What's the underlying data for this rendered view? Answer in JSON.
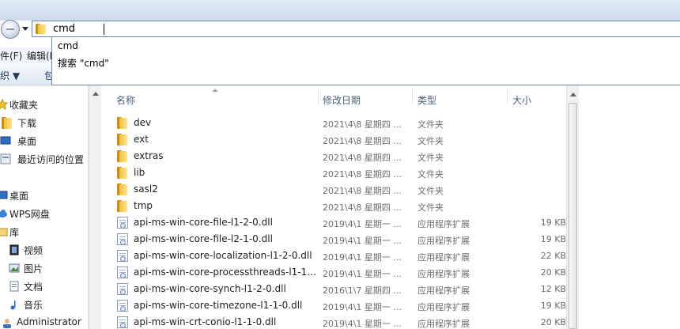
{
  "address": {
    "input_value": "cmd",
    "suggestions": [
      "cmd",
      "搜索 \"cmd\""
    ]
  },
  "menu": [
    "件(F)",
    "编辑(E"
  ],
  "toolbar": [
    "织 ▼",
    "包"
  ],
  "nav": [
    {
      "label": "收藏夹",
      "icon": "star-icon"
    },
    {
      "label": "下载",
      "icon": "download-icon"
    },
    {
      "label": "桌面",
      "icon": "desktop-icon"
    },
    {
      "label": "最近访问的位置",
      "icon": "recent-places-icon"
    },
    {
      "label": "桌面",
      "icon": "desktop-icon"
    },
    {
      "label": "WPS网盘",
      "icon": "cloud-icon"
    },
    {
      "label": "库",
      "icon": "library-icon"
    },
    {
      "label": "视频",
      "icon": "video-icon"
    },
    {
      "label": "图片",
      "icon": "picture-icon"
    },
    {
      "label": "文档",
      "icon": "document-icon"
    },
    {
      "label": "音乐",
      "icon": "music-icon"
    },
    {
      "label": "Administrator",
      "icon": "user-icon"
    }
  ],
  "columns": [
    "名称",
    "修改日期",
    "类型",
    "大小"
  ],
  "files": [
    {
      "name": "dev",
      "date": "2021\\4\\8 星期四 ...",
      "type": "文件夹",
      "size": "",
      "kind": "folder"
    },
    {
      "name": "ext",
      "date": "2021\\4\\8 星期四 ...",
      "type": "文件夹",
      "size": "",
      "kind": "folder"
    },
    {
      "name": "extras",
      "date": "2021\\4\\8 星期四 ...",
      "type": "文件夹",
      "size": "",
      "kind": "folder"
    },
    {
      "name": "lib",
      "date": "2021\\4\\8 星期四 ...",
      "type": "文件夹",
      "size": "",
      "kind": "folder"
    },
    {
      "name": "sasl2",
      "date": "2021\\4\\8 星期四 ...",
      "type": "文件夹",
      "size": "",
      "kind": "folder"
    },
    {
      "name": "tmp",
      "date": "2021\\4\\8 星期四 ...",
      "type": "文件夹",
      "size": "",
      "kind": "folder"
    },
    {
      "name": "api-ms-win-core-file-l1-2-0.dll",
      "date": "2019\\4\\1 星期一 ...",
      "type": "应用程序扩展",
      "size": "19 KB",
      "kind": "dll"
    },
    {
      "name": "api-ms-win-core-file-l2-1-0.dll",
      "date": "2019\\4\\1 星期一 ...",
      "type": "应用程序扩展",
      "size": "19 KB",
      "kind": "dll"
    },
    {
      "name": "api-ms-win-core-localization-l1-2-0.dll",
      "date": "2019\\4\\1 星期一 ...",
      "type": "应用程序扩展",
      "size": "22 KB",
      "kind": "dll"
    },
    {
      "name": "api-ms-win-core-processthreads-l1-1...",
      "date": "2019\\4\\1 星期一 ...",
      "type": "应用程序扩展",
      "size": "20 KB",
      "kind": "dll"
    },
    {
      "name": "api-ms-win-core-synch-l1-2-0.dll",
      "date": "2016\\1\\7 星期四 ...",
      "type": "应用程序扩展",
      "size": "12 KB",
      "kind": "dll"
    },
    {
      "name": "api-ms-win-core-timezone-l1-1-0.dll",
      "date": "2019\\4\\1 星期一 ...",
      "type": "应用程序扩展",
      "size": "19 KB",
      "kind": "dll"
    },
    {
      "name": "api-ms-win-crt-conio-l1-1-0.dll",
      "date": "2019\\4\\1 星期一 ...",
      "type": "应用程序扩展",
      "size": "20 KB",
      "kind": "dll"
    }
  ]
}
